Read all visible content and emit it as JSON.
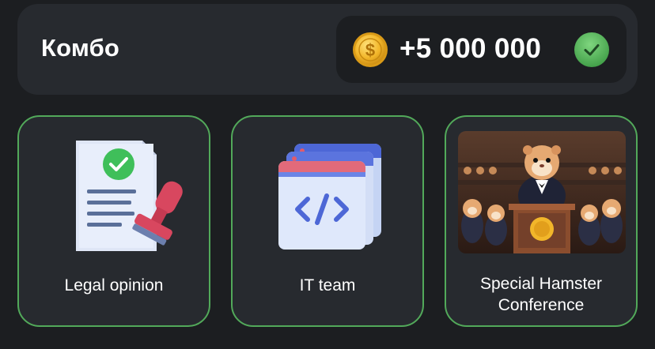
{
  "combo": {
    "title": "Комбо",
    "reward": "+5 000 000",
    "reward_icon": "coin-icon",
    "status_icon": "checkmark-icon"
  },
  "cards": [
    {
      "label": "Legal opinion",
      "icon": "legal-document-stamp-icon"
    },
    {
      "label": "IT team",
      "icon": "code-windows-icon"
    },
    {
      "label_lines": [
        "Special Hamster",
        "Conference"
      ],
      "icon": "hamster-conference-image"
    }
  ],
  "colors": {
    "background": "#1c1e21",
    "panel": "#272a2f",
    "card_border": "#52a95a",
    "check_green": "#5ab55f",
    "coin_gold": "#f2b62a"
  }
}
